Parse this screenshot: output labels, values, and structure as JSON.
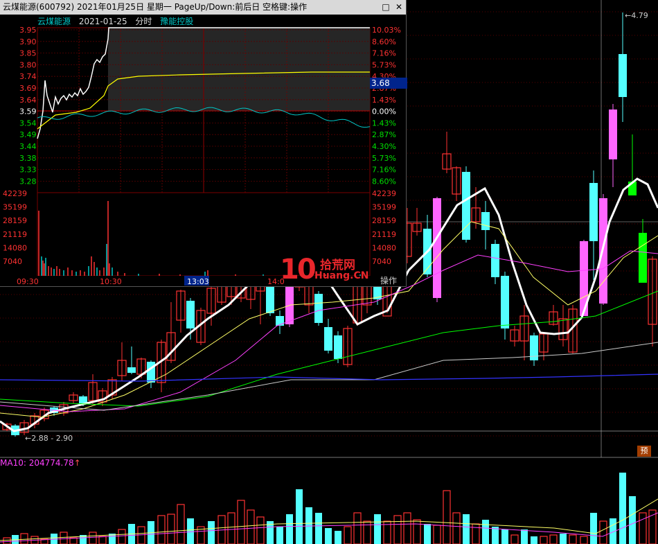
{
  "window": {
    "title": "云煤能源(600792) 2021年01月25日 星期一 PageUp/Down:前后日 空格键:操作",
    "restore_icon": "□",
    "close_icon": "✕"
  },
  "infobar": {
    "stock_name": "云煤能源",
    "date": "2021-01-25",
    "mode": "分时",
    "sector": "豫能控股"
  },
  "intraday": {
    "price_ticks": [
      "3.95",
      "3.90",
      "3.85",
      "3.80",
      "3.74",
      "3.69",
      "3.64",
      "3.59",
      "3.54",
      "3.49",
      "3.44",
      "3.38",
      "3.33",
      "3.28"
    ],
    "pct_ticks": [
      "10.03%",
      "8.60%",
      "7.16%",
      "5.73%",
      "4.30%",
      "2.87%",
      "1.43%",
      "0.00%",
      "1.43%",
      "2.87%",
      "4.30%",
      "5.73%",
      "7.16%",
      "8.60%"
    ],
    "volume_ticks": [
      "42239",
      "35199",
      "28159",
      "21119",
      "14080",
      "7040"
    ],
    "time_ticks": [
      "09:30",
      "10:30",
      "13:03",
      "14:0"
    ],
    "current_price_tag": "3.68",
    "operate_label": "操作",
    "colors": {
      "up": "#ff3232",
      "down": "#00c8c8",
      "price_line": "#ffffff",
      "avg_line": "#ffff00",
      "ref_line": "#00c8c8"
    }
  },
  "kline": {
    "high_label": "4.79",
    "low_label": "2.88",
    "low_label_2": "2.90",
    "pre_badge": "预",
    "ma_label": "MA10: 204774.78",
    "ma_arrow": "↑"
  },
  "watermark": {
    "number": "10",
    "cn": "拾荒网",
    "en": "Huang.CN"
  }
}
